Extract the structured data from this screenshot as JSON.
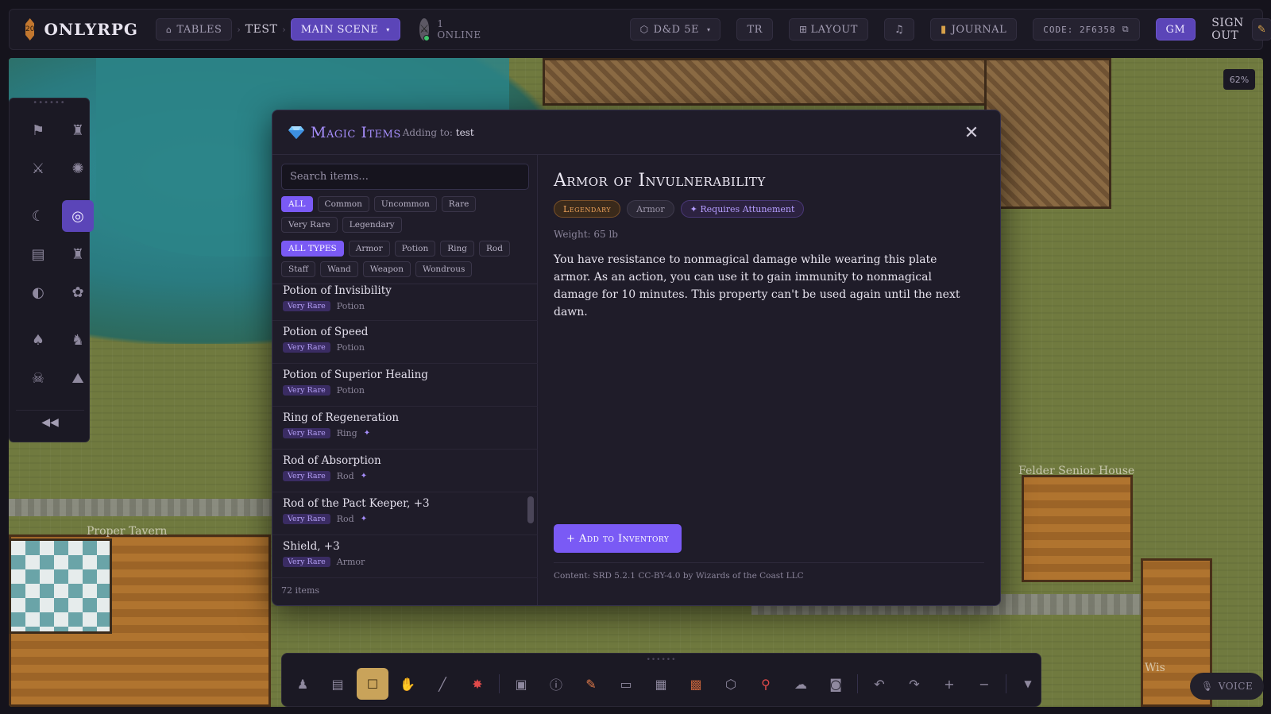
{
  "topbar": {
    "logo_die": "20",
    "brand": "ONLYRPG",
    "tables_label": "TABLES",
    "table_name": "TEST",
    "scene_label": "MAIN SCENE",
    "online": "1 ONLINE",
    "system_label": "D&D 5E",
    "tr_label": "TR",
    "layout_label": "LAYOUT",
    "journal_label": "JOURNAL",
    "code_label": "CODE: 2F6358",
    "gm_label": "GM",
    "signout_label": "SIGN OUT"
  },
  "map": {
    "zoom": "62%",
    "labels": [
      "Felder Senior House",
      "Proper Tavern",
      "Wis"
    ]
  },
  "palette": {
    "collapse_label": "◀◀"
  },
  "modal": {
    "title": "Magic Items",
    "adding_prefix": "Adding to:",
    "adding_target": "test",
    "search_placeholder": "Search items...",
    "rarity_filters": [
      "ALL",
      "Common",
      "Uncommon",
      "Rare",
      "Very Rare",
      "Legendary"
    ],
    "type_filters": [
      "ALL TYPES",
      "Armor",
      "Potion",
      "Ring",
      "Rod",
      "Staff",
      "Wand",
      "Weapon",
      "Wondrous"
    ],
    "items": [
      {
        "name": "Potion of Invisibility",
        "rarity": "Very Rare",
        "type": "Potion",
        "attune": ""
      },
      {
        "name": "Potion of Speed",
        "rarity": "Very Rare",
        "type": "Potion",
        "attune": ""
      },
      {
        "name": "Potion of Superior Healing",
        "rarity": "Very Rare",
        "type": "Potion",
        "attune": ""
      },
      {
        "name": "Ring of Regeneration",
        "rarity": "Very Rare",
        "type": "Ring",
        "attune": "✦"
      },
      {
        "name": "Rod of Absorption",
        "rarity": "Very Rare",
        "type": "Rod",
        "attune": "✦"
      },
      {
        "name": "Rod of the Pact Keeper, +3",
        "rarity": "Very Rare",
        "type": "Rod",
        "attune": "✦"
      },
      {
        "name": "Shield, +3",
        "rarity": "Very Rare",
        "type": "Armor",
        "attune": ""
      }
    ],
    "count": "72 items",
    "detail": {
      "title": "Armor of Invulnerability",
      "rarity": "Legendary",
      "type": "Armor",
      "attunement": "✦ Requires Attunement",
      "weight": "Weight: 65 lb",
      "description": "You have resistance to nonmagical damage while wearing this plate armor. As an action, you can use it to gain immunity to nonmagical damage for 10 minutes. This property can't be used again until the next dawn.",
      "add_label": "+ Add to Inventory",
      "credit": "Content: SRD 5.2.1 CC-BY-4.0 by Wizards of the Coast LLC"
    }
  },
  "bottombar": {
    "voice_label": "VOICE"
  },
  "colors": {
    "accent": "#7a5af5",
    "accent_dark": "#5b45b8",
    "legendary": "#f0a45b"
  }
}
